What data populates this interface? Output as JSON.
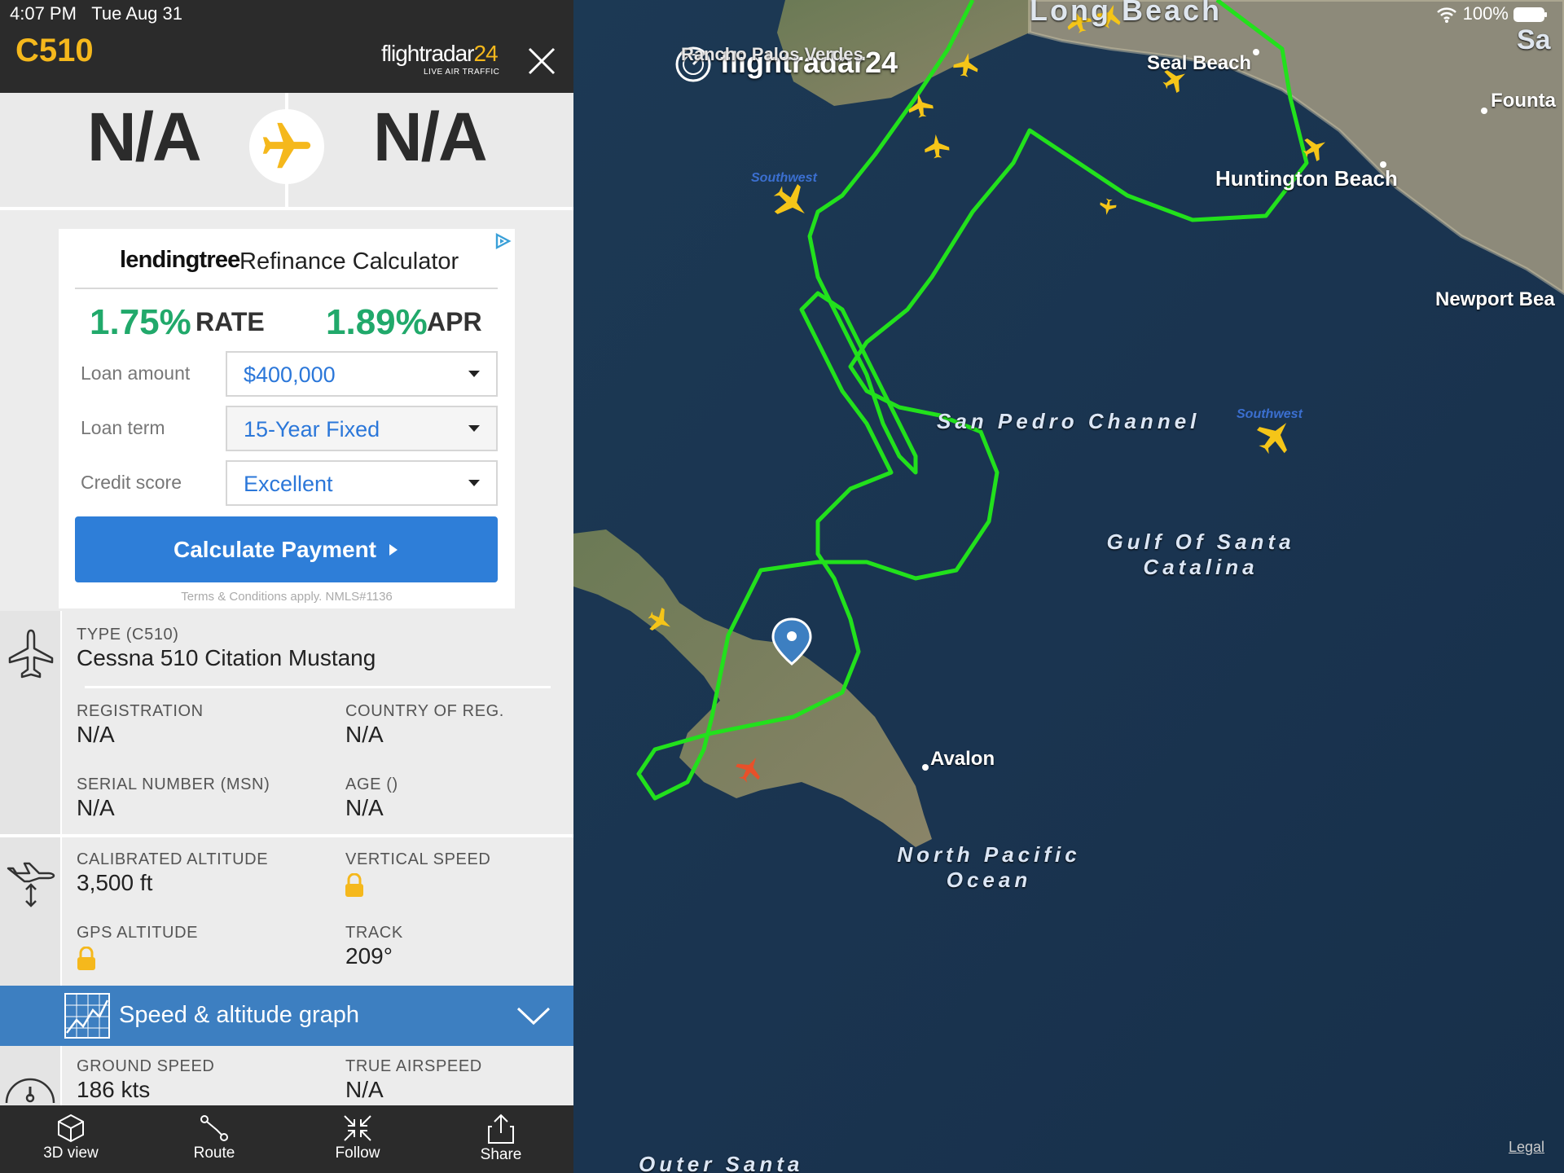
{
  "status_bar": {
    "time": "4:07 PM",
    "date": "Tue Aug 31",
    "battery": "100%"
  },
  "header": {
    "callsign": "C510",
    "logo_main": "flightradar",
    "logo_num": "24",
    "logo_sub": "LIVE AIR TRAFFIC"
  },
  "route": {
    "from": "N/A",
    "to": "N/A"
  },
  "ad": {
    "brand": "lendingtree",
    "title": "Refinance Calculator",
    "rate_value": "1.75%",
    "rate_label": "RATE",
    "apr_value": "1.89%",
    "apr_label": "APR",
    "rows": [
      {
        "label": "Loan amount",
        "value": "$400,000"
      },
      {
        "label": "Loan term",
        "value": "15-Year Fixed"
      },
      {
        "label": "Credit score",
        "value": "Excellent"
      }
    ],
    "button": "Calculate Payment",
    "terms": "Terms & Conditions apply. NMLS#1136"
  },
  "aircraft": {
    "type_label": "TYPE (C510)",
    "type_value": "Cessna 510 Citation Mustang",
    "registration_label": "REGISTRATION",
    "registration_value": "N/A",
    "country_label": "COUNTRY OF REG.",
    "country_value": "N/A",
    "serial_label": "SERIAL NUMBER (MSN)",
    "serial_value": "N/A",
    "age_label": "AGE ()",
    "age_value": "N/A"
  },
  "altitude": {
    "cal_alt_label": "CALIBRATED ALTITUDE",
    "cal_alt_value": "3,500 ft",
    "vs_label": "VERTICAL SPEED",
    "gps_alt_label": "GPS ALTITUDE",
    "track_label": "TRACK",
    "track_value": "209°"
  },
  "graph_bar": {
    "title": "Speed & altitude graph"
  },
  "speed": {
    "ground_label": "GROUND SPEED",
    "ground_value": "186 kts",
    "tas_label": "TRUE AIRSPEED",
    "tas_value": "N/A"
  },
  "tabs": [
    {
      "label": "3D view",
      "icon": "cube-icon"
    },
    {
      "label": "Route",
      "icon": "route-icon"
    },
    {
      "label": "Follow",
      "icon": "follow-icon"
    },
    {
      "label": "Share",
      "icon": "share-icon"
    }
  ],
  "map": {
    "watermark": "flightradar24",
    "places": {
      "long_beach": "Long Beach",
      "seal_beach": "Seal Beach",
      "huntington_beach": "Huntington Beach",
      "fountain": "Founta",
      "newport": "Newport Bea",
      "avalon": "Avalon",
      "rancho": "Rancho Palos Verdes",
      "sa": "Sa"
    },
    "water": {
      "channel": "San Pedro Channel",
      "gulf_1": "Gulf Of Santa",
      "gulf_2": "Catalina",
      "ocean_1": "North Pacific",
      "ocean_2": "Ocean",
      "outer": "Outer Santa"
    },
    "airline_tag": "Southwest",
    "legal": "Legal",
    "colors": {
      "track": "#22e11c",
      "aircraft": "#f5c518",
      "selected_aircraft": "#e8502a"
    }
  }
}
